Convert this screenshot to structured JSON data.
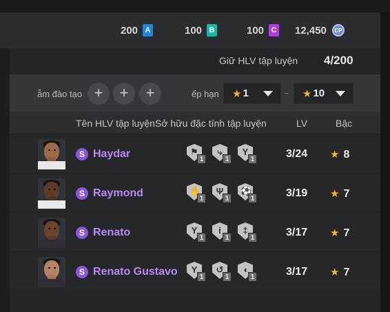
{
  "currencies": [
    {
      "value": "200",
      "badge": "A",
      "color": "#1f86d9"
    },
    {
      "value": "100",
      "badge": "B",
      "color": "#18b8a3"
    },
    {
      "value": "100",
      "badge": "C",
      "color": "#b03de0"
    },
    {
      "value": "12,450",
      "badge": "CP",
      "color": "#6f8cc9"
    }
  ],
  "coach_count": {
    "label": "Giữ HLV tập luyện",
    "value": "4/200"
  },
  "filters": {
    "training_label": "ẫm đào tạo",
    "rank_label": "ếp hạn",
    "rank_from": "1",
    "rank_to": "10",
    "separator": "~"
  },
  "columns": {
    "name": "Tên HLV tập luyện",
    "traits": "Sở hữu đặc tính tập luyện",
    "level": "LV",
    "rank": "Bậc"
  },
  "rows": [
    {
      "name": "Haydar",
      "level": "3/24",
      "rank": "8",
      "badge": "S",
      "traits": [
        {
          "icon": "boot-trait-icon",
          "level": "1"
        },
        {
          "icon": "slide-tackle-trait-icon",
          "level": "1"
        },
        {
          "icon": "strength-trait-icon",
          "level": "1"
        }
      ]
    },
    {
      "name": "Raymond",
      "level": "3/19",
      "rank": "7",
      "badge": "S",
      "traits": [
        {
          "icon": "keeper-trait-icon",
          "level": "1"
        },
        {
          "icon": "stretch-trait-icon",
          "level": "1"
        },
        {
          "icon": "dribble-trait-icon",
          "level": "1"
        }
      ]
    },
    {
      "name": "Renato",
      "level": "3/17",
      "rank": "7",
      "badge": "S",
      "traits": [
        {
          "icon": "strength-trait-icon",
          "level": "1"
        },
        {
          "icon": "ball-control-trait-icon",
          "level": "1"
        },
        {
          "icon": "balance-trait-icon",
          "level": "1"
        }
      ]
    },
    {
      "name": "Renato Gustavo",
      "level": "3/17",
      "rank": "7",
      "badge": "S",
      "traits": [
        {
          "icon": "strength-trait-icon",
          "level": "1"
        },
        {
          "icon": "curve-trait-icon",
          "level": "1"
        },
        {
          "icon": "shield-trait-icon",
          "level": "1"
        }
      ]
    }
  ]
}
